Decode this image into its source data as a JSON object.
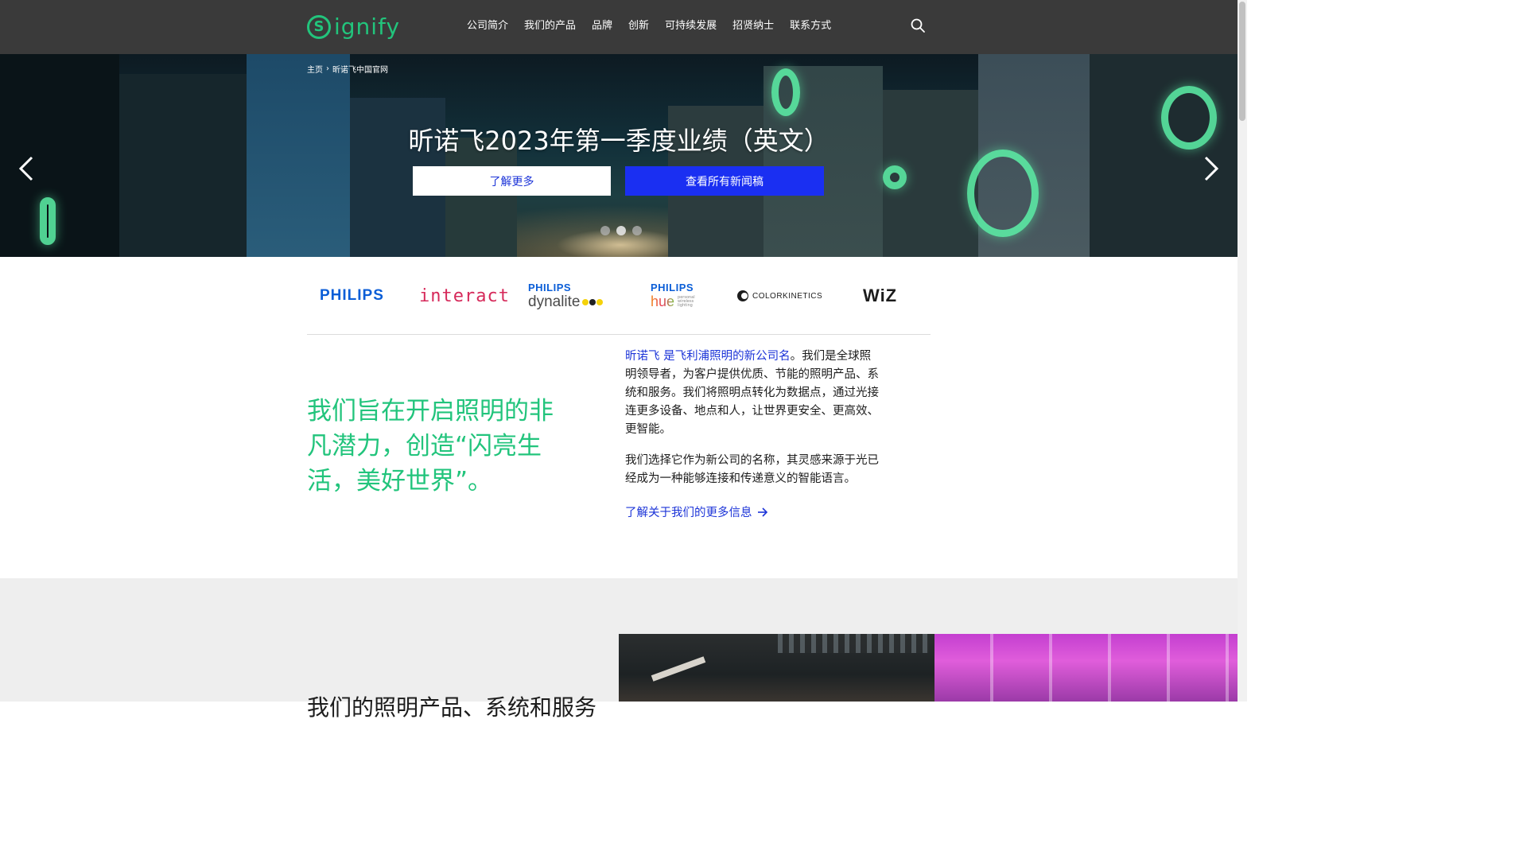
{
  "header": {
    "logo_text": "ignify",
    "logo_mark": "S",
    "nav": [
      "公司简介",
      "我们的产品",
      "品牌",
      "创新",
      "可持续发展",
      "招贤纳士",
      "联系方式"
    ],
    "search_icon": "search-icon"
  },
  "hero": {
    "breadcrumb": [
      "主页",
      "昕诺飞中国官网"
    ],
    "title": "昕诺飞2023年第一季度业绩（英文）",
    "learn_more": "了解更多",
    "view_news": "查看所有新闻稿",
    "dots_count": 3,
    "active_dot": 1
  },
  "brands": {
    "philips": "PHILIPS",
    "interact": "interact",
    "dynalite_brand": "PHILIPS",
    "dynalite": "dynalite",
    "hue_brand": "PHILIPS",
    "hue": "hue",
    "hue_small": "personal wireless lighting",
    "colorkinetics": "COLORKINETICS",
    "wiz": "WiZ"
  },
  "about": {
    "tagline": "我们旨在开启照明的非凡潜力，创造“闪亮生活，美好世界”。",
    "link_text": "昕诺飞 是飞利浦照明的新公司名",
    "para1_rest": "。我们是全球照明领导者，为客户提供优质、节能的照明产品、系统和服务。我们将照明点转化为数据点，通过光接连更多设备、地点和人，让世界更安全、更高效、更智能。",
    "para2": "我们选择它作为新公司的名称，其灵感来源于光已经成为一种能够连接和传递意义的智能语言。",
    "more_link": "了解关于我们的更多信息"
  },
  "bottom": {
    "heading": "我们的照明产品、系统和服务"
  },
  "colors": {
    "brand_green": "#22c47c",
    "link_blue": "#1c34d8",
    "button_blue": "#1a2ff2",
    "header_bg": "#3a3a3a"
  }
}
